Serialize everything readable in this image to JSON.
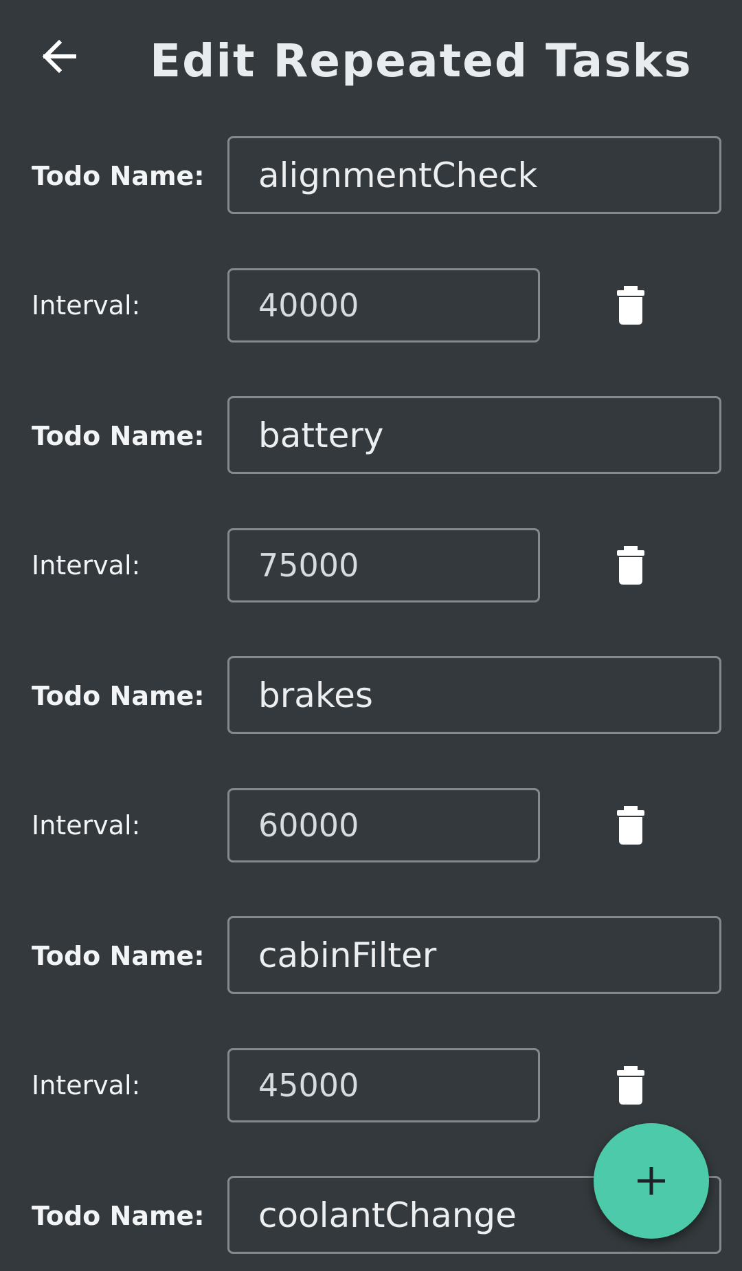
{
  "header": {
    "title": "Edit Repeated Tasks"
  },
  "labels": {
    "todo_name": "Todo Name:",
    "interval": "Interval:"
  },
  "tasks": [
    {
      "name": "alignmentCheck",
      "interval": "40000"
    },
    {
      "name": "battery",
      "interval": "75000"
    },
    {
      "name": "brakes",
      "interval": "60000"
    },
    {
      "name": "cabinFilter",
      "interval": "45000"
    },
    {
      "name": "coolantChange"
    }
  ],
  "icons": {
    "back": "arrow-left-icon",
    "delete": "trash-icon",
    "add": "plus-icon"
  },
  "colors": {
    "background": "#33393c",
    "accent": "#4ccaa9",
    "field_border": "#85898c",
    "text": "#eef0f1"
  }
}
